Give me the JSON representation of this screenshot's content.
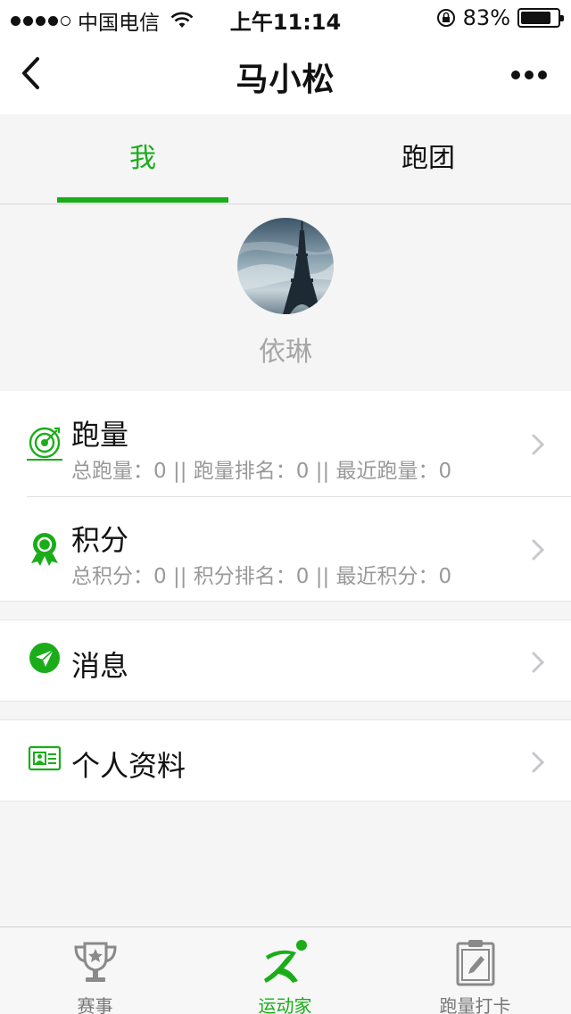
{
  "status_bar": {
    "carrier": "中国电信",
    "time": "上午11:14",
    "battery": "83%",
    "battery_level": 0.83
  },
  "nav": {
    "title": "马小松"
  },
  "tabs": [
    {
      "label": "我",
      "active": true
    },
    {
      "label": "跑团",
      "active": false
    }
  ],
  "profile": {
    "username": "依琳"
  },
  "list": {
    "running": {
      "title": "跑量",
      "subtitle": "总跑量：0 || 跑量排名：0 || 最近跑量：0",
      "icon": "target-icon"
    },
    "points": {
      "title": "积分",
      "subtitle": "总积分：0 || 积分排名：0 || 最近积分：0",
      "icon": "medal-icon"
    },
    "messages": {
      "title": "消息",
      "icon": "paper-plane-icon"
    },
    "profile_info": {
      "title": "个人资料",
      "icon": "id-card-icon"
    }
  },
  "tabbar": [
    {
      "label": "赛事",
      "icon": "trophy-icon",
      "active": false
    },
    {
      "label": "运动家",
      "icon": "runner-icon",
      "active": true
    },
    {
      "label": "跑量打卡",
      "icon": "clipboard-icon",
      "active": false
    }
  ],
  "colors": {
    "accent": "#1aad19",
    "muted_text": "#999999",
    "background": "#f5f5f5"
  }
}
